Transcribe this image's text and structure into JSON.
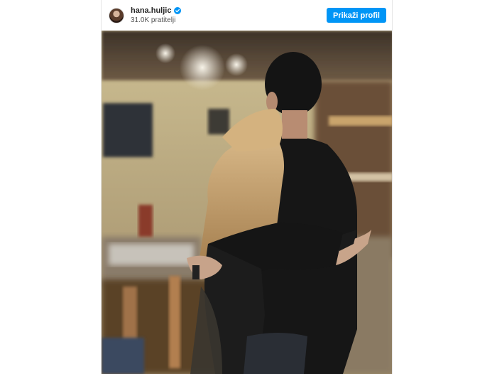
{
  "post": {
    "username": "hana.huljic",
    "verified": true,
    "followers": "31.0K pratitelji",
    "view_profile_label": "Prikaži profil",
    "image_description": "blurred-restaurant-embrace",
    "icons": {
      "avatar": "profile-photo",
      "verified": "verified-badge-icon"
    },
    "colors": {
      "button": "#0095f6",
      "verified": "#0095f6"
    }
  }
}
